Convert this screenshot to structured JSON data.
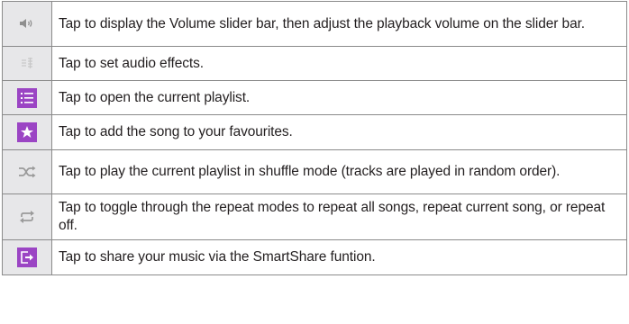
{
  "rows": [
    {
      "icon": "volume-icon",
      "text": "Tap to display the Volume slider bar, then adjust the playback volume on the slider bar."
    },
    {
      "icon": "audio-effects-icon",
      "text": "Tap to set audio effects."
    },
    {
      "icon": "playlist-icon",
      "text": "Tap to open the current playlist."
    },
    {
      "icon": "favourite-star-icon",
      "text": "Tap to add the song to your favourites."
    },
    {
      "icon": "shuffle-icon",
      "text": "Tap to play the current playlist in shuffle mode (tracks are played in random order)."
    },
    {
      "icon": "repeat-icon",
      "text": "Tap to toggle through the repeat modes to repeat all songs, repeat current song, or repeat off."
    },
    {
      "icon": "share-icon",
      "text": "Tap to share your music via the SmartShare funtion."
    }
  ],
  "colors": {
    "icon_cell_bg": "#e7e7e9",
    "accent_purple": "#9b45c4",
    "icon_gray": "#9a9a9a",
    "border": "#8a8a8a"
  }
}
